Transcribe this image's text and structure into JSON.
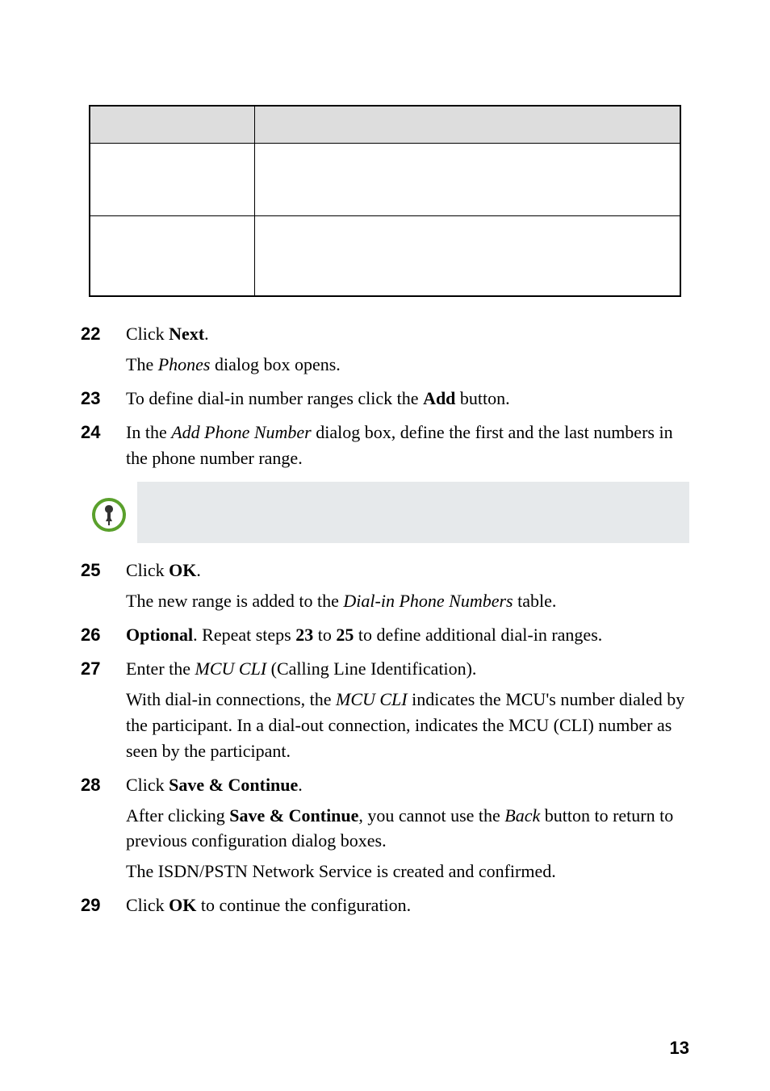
{
  "table": {
    "headers": [
      "",
      ""
    ],
    "rows": [
      [
        "",
        ""
      ],
      [
        "",
        ""
      ]
    ]
  },
  "steps": {
    "s22": {
      "num": "22",
      "pre": "Click ",
      "bold": "Next",
      "post": ".",
      "sub_pre": "The ",
      "sub_em": "Phones",
      "sub_post": " dialog box opens."
    },
    "s23": {
      "num": "23",
      "pre": "To define dial-in number ranges click the ",
      "bold": "Add",
      "post": " button."
    },
    "s24": {
      "num": "24",
      "pre": "In the ",
      "em": "Add Phone Number",
      "post": " dialog box, define the first and the last numbers in the phone number range."
    },
    "s25": {
      "num": "25",
      "pre": "Click ",
      "bold": "OK",
      "post": ".",
      "sub_pre": "The new range is added to the ",
      "sub_em": "Dial-in Phone Numbers",
      "sub_post": " table."
    },
    "s26": {
      "num": "26",
      "bold1": "Optional",
      "mid1": ". Repeat steps ",
      "bold2": "23",
      "mid2": " to ",
      "bold3": "25",
      "post": " to define additional dial-in ranges."
    },
    "s27": {
      "num": "27",
      "pre": "Enter the ",
      "em": "MCU CLI",
      "post": " (Calling Line Identification).",
      "sub_pre": "With dial-in connections, the ",
      "sub_em": "MCU CLI",
      "sub_post": " indicates the MCU's number dialed by the participant. In a dial-out connection, indicates the MCU (CLI) number as seen by the participant."
    },
    "s28": {
      "num": "28",
      "pre": "Click ",
      "bold": "Save & Continue",
      "post": ".",
      "sub1_pre": "After clicking ",
      "sub1_bold": "Save & Continue",
      "sub1_mid": ", you cannot use the ",
      "sub1_em": "Back",
      "sub1_post": " button to return to previous configuration dialog boxes.",
      "sub2": "The ISDN/PSTN Network Service is created and confirmed."
    },
    "s29": {
      "num": "29",
      "pre": "Click ",
      "bold": "OK",
      "post": " to continue the configuration."
    }
  },
  "page_number": "13"
}
